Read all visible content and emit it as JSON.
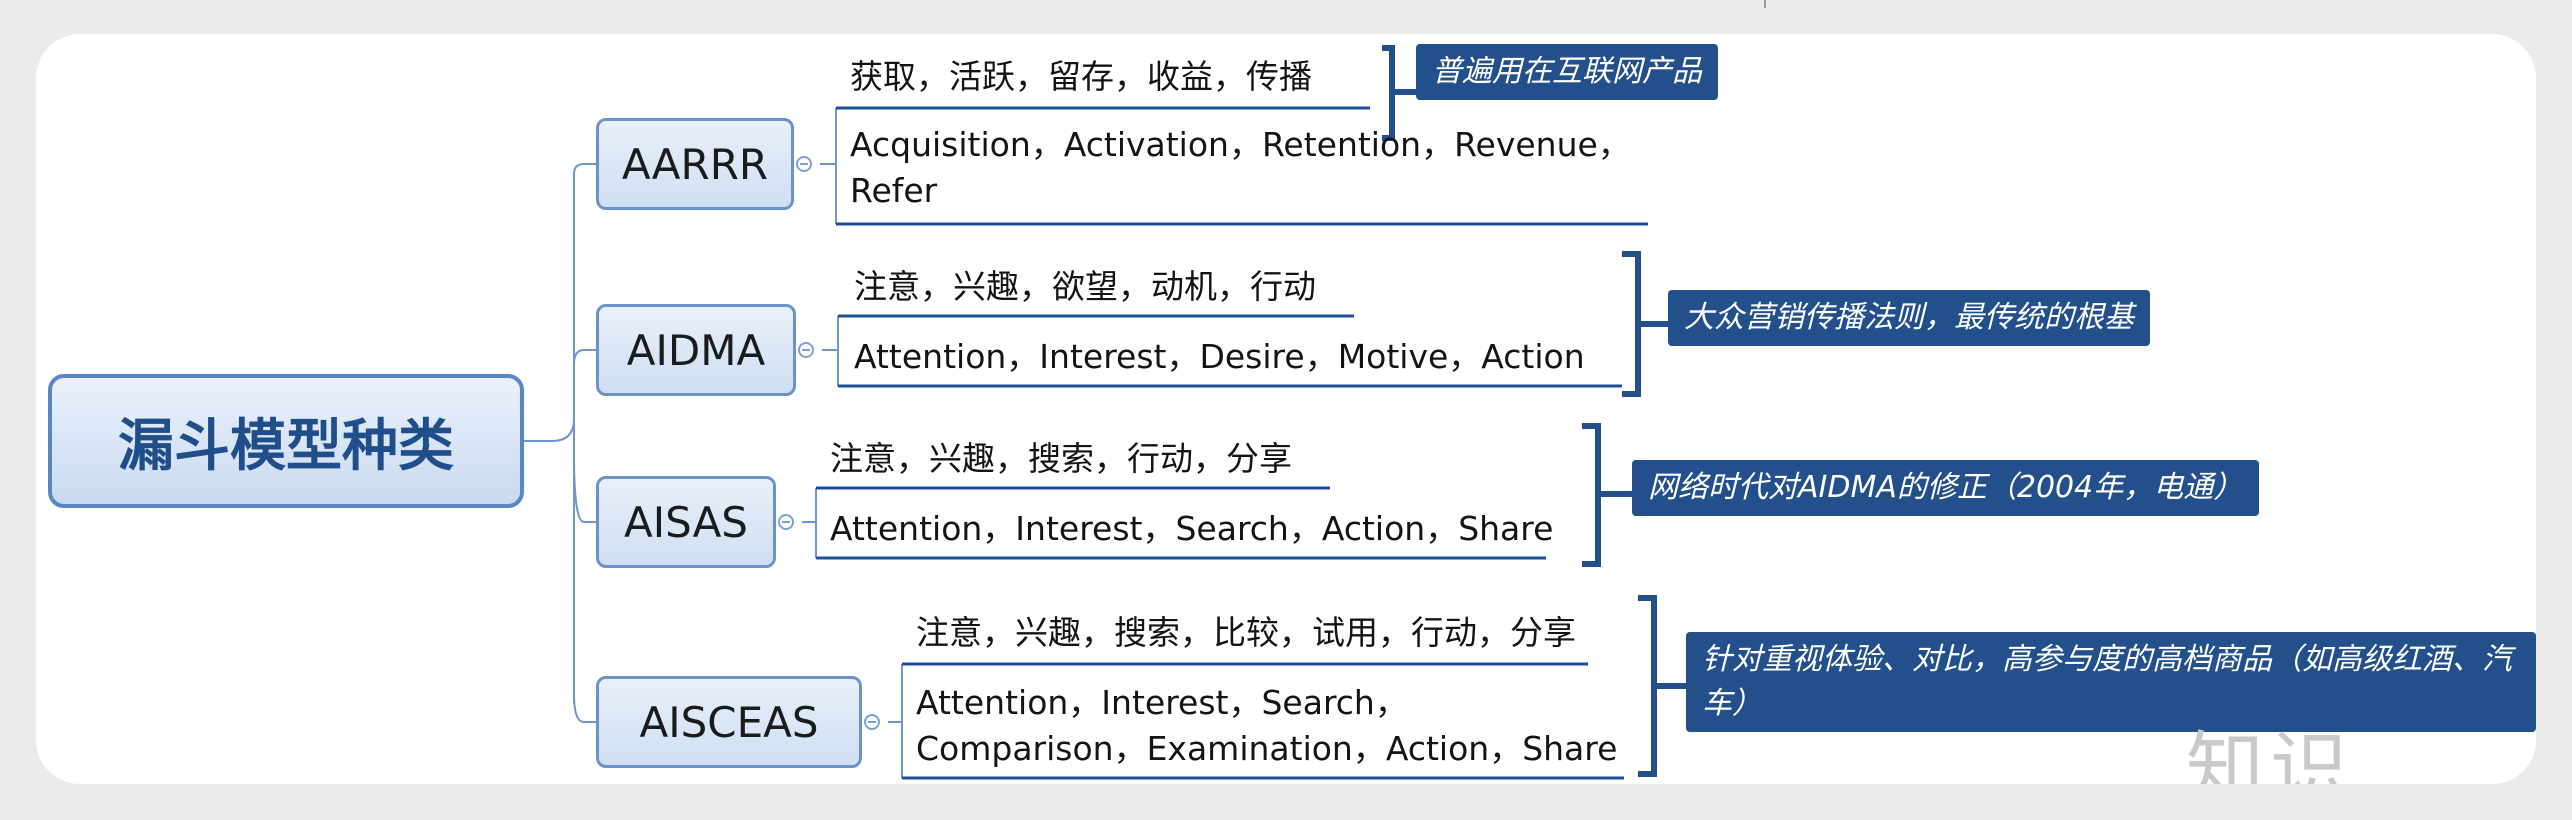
{
  "root": {
    "label": "漏斗模型种类"
  },
  "models": [
    {
      "name": "AARRR",
      "cn": "获取，活跃，留存，收益，传播",
      "en": "Acquisition，Activation，Retention，Revenue，Refer",
      "note": "普遍用在互联网产品"
    },
    {
      "name": "AIDMA",
      "cn": "注意，兴趣，欲望，动机，行动",
      "en": "Attention，Interest，Desire，Motive，Action",
      "note": "大众营销传播法则，最传统的根基"
    },
    {
      "name": "AISAS",
      "cn": "注意，兴趣，搜索，行动，分享",
      "en": "Attention，Interest，Search，Action，Share",
      "note": "网络时代对AIDMA的修正（2004年，电通）"
    },
    {
      "name": "AISCEAS",
      "cn": "注意，兴趣，搜索，比较，试用，行动，分享",
      "en": "Attention，Interest，Search，Comparison，Examination，Action，Share",
      "note": "针对重视体验、对比，高参与度的高档商品（如高级红酒、汽车）"
    }
  ],
  "watermark": "知识",
  "colors": {
    "line": "#6f96cf",
    "underline": "#1f4f9a",
    "bracket": "#23508a",
    "note_bg": "#23508a"
  }
}
